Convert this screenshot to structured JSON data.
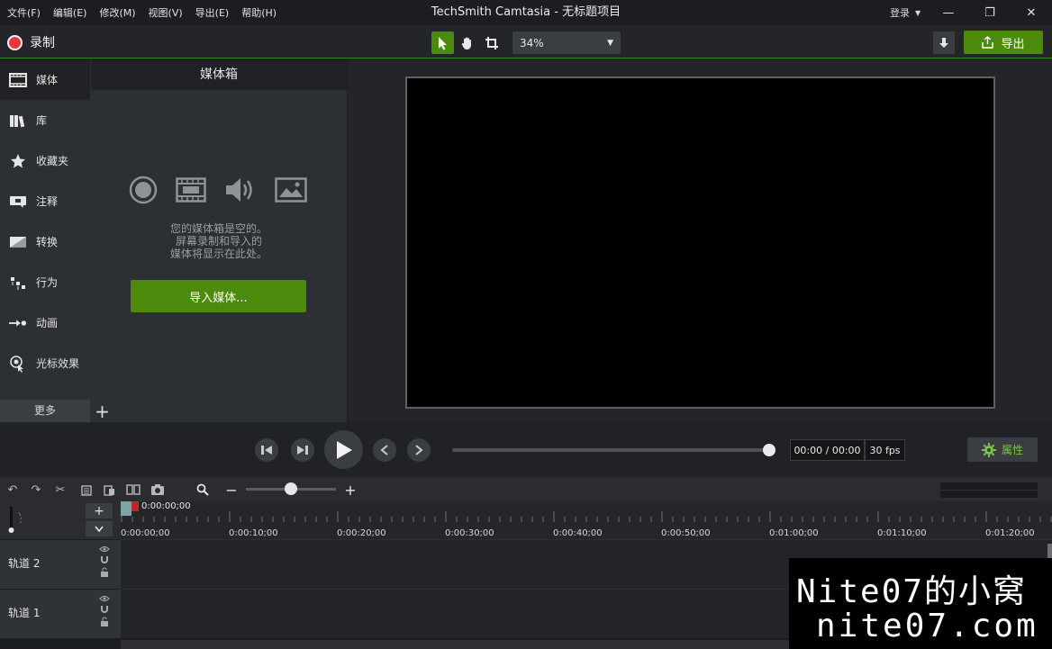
{
  "menu": [
    "文件(F)",
    "编辑(E)",
    "修改(M)",
    "视图(V)",
    "导出(E)",
    "帮助(H)"
  ],
  "app_title": "TechSmith Camtasia - 无标题项目",
  "login_label": "登录",
  "window_controls": {
    "minimize": "—",
    "restore": "❐",
    "close": "✕"
  },
  "toolbar": {
    "record_label": "录制",
    "zoom_value": "34%",
    "export_label": "导出",
    "accent_color": "#4c8a0b"
  },
  "sidebar": {
    "items": [
      {
        "label": "媒体",
        "icon": "film-strip-icon"
      },
      {
        "label": "库",
        "icon": "library-icon"
      },
      {
        "label": "收藏夹",
        "icon": "star-icon"
      },
      {
        "label": "注释",
        "icon": "annotation-icon"
      },
      {
        "label": "转换",
        "icon": "transition-icon"
      },
      {
        "label": "行为",
        "icon": "behavior-icon"
      },
      {
        "label": "动画",
        "icon": "animation-icon"
      },
      {
        "label": "光标效果",
        "icon": "cursor-effect-icon"
      }
    ],
    "more_label": "更多",
    "add_label": "+"
  },
  "media_bin": {
    "title": "媒体箱",
    "empty_line1": "您的媒体箱是空的。",
    "empty_line2": "屏幕录制和导入的",
    "empty_line3": "媒体将显示在此处。",
    "import_label": "导入媒体..."
  },
  "player": {
    "timecode": "00:00 / 00:00",
    "fps": "30 fps",
    "properties_label": "属性"
  },
  "timeline": {
    "playhead_time": "0:00:00;00",
    "ruler_labels": [
      "0:00:00;00",
      "0:00:10;00",
      "0:00:20;00",
      "0:00:30;00",
      "0:00:40;00",
      "0:00:50;00",
      "0:01:00;00",
      "0:01:10;00",
      "0:01:20;00"
    ],
    "tracks": [
      {
        "name": "轨道 2"
      },
      {
        "name": "轨道 1"
      }
    ]
  },
  "watermark": {
    "line1": "Nite07的小窝",
    "line2": "nite07.com"
  }
}
